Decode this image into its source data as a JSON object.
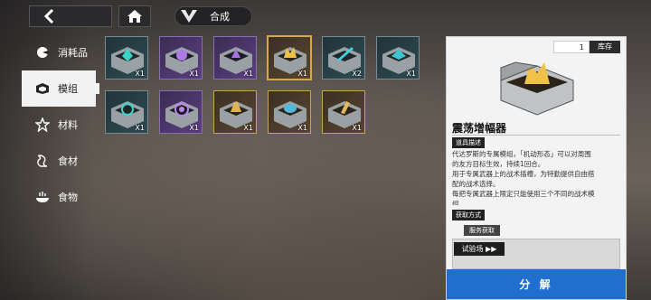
{
  "topbar": {
    "back_icon": "chevron-left-icon",
    "home_icon": "home-icon",
    "synth_icon": "craft-logo-icon",
    "synth_label": "合成"
  },
  "sidebar": {
    "items": [
      {
        "label": "消耗品",
        "icon": "pie-icon",
        "active": false
      },
      {
        "label": "模组",
        "icon": "module-icon",
        "active": true
      },
      {
        "label": "材料",
        "icon": "star-icon",
        "active": false
      },
      {
        "label": "食材",
        "icon": "ingredient-icon",
        "active": false
      },
      {
        "label": "食物",
        "icon": "dish-icon",
        "active": false
      }
    ]
  },
  "grid": {
    "items": [
      {
        "qty": "X1",
        "rarity": "teal"
      },
      {
        "qty": "X1",
        "rarity": "purple"
      },
      {
        "qty": "X1",
        "rarity": "purple"
      },
      {
        "qty": "X1",
        "rarity": "gold",
        "selected": true
      },
      {
        "qty": "X2",
        "rarity": "teal"
      },
      {
        "qty": "X1",
        "rarity": "teal"
      },
      {
        "qty": "X1",
        "rarity": "teal"
      },
      {
        "qty": "X1",
        "rarity": "purple"
      },
      {
        "qty": "X1",
        "rarity": "gold"
      },
      {
        "qty": "X1",
        "rarity": "gold"
      },
      {
        "qty": "X1",
        "rarity": "gold"
      }
    ]
  },
  "detail": {
    "stock_count": "1",
    "stock_label": "库存",
    "name": "震荡增幅器",
    "desc_label": "道具描述",
    "desc_lines": [
      "代达罗斯的专属模组，「机动形态」可以对周围",
      "的友方目标生效，持续1回合。",
      "用于专属武器上的战术插槽，为特勤提供自由搭",
      "配的战术选择。",
      "每把专属武器上限定只能使用三个不同的战术模",
      "组"
    ],
    "source_label": "获取方式",
    "service_label": "服务获取",
    "trial_label": "试验场 ▶▶",
    "decompose_label": "分 解"
  },
  "colors": {
    "accent_blue": "#1e6fcf",
    "rarity_gold": "#c7a25a",
    "rarity_purple": "#8a6fb0",
    "rarity_teal": "#7c8a8e"
  }
}
